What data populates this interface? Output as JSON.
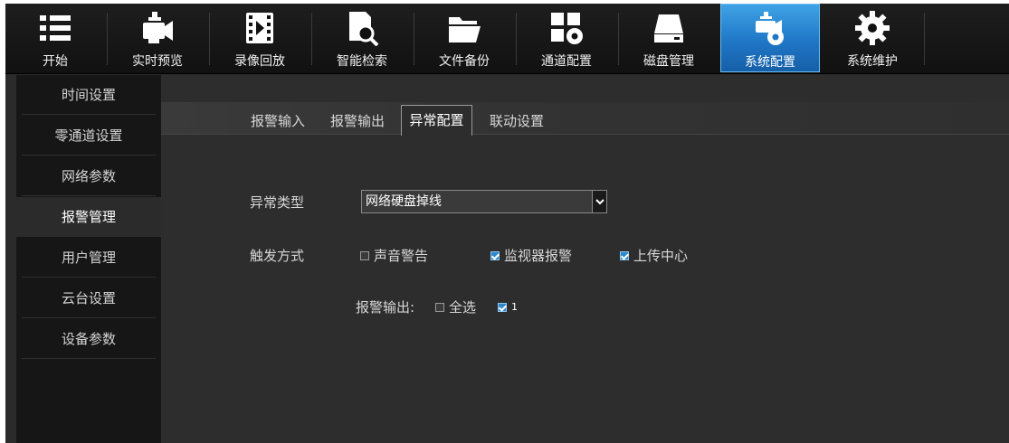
{
  "toolbar": {
    "items": [
      {
        "label": "开始",
        "icon": "list-icon"
      },
      {
        "label": "实时预览",
        "icon": "camera-icon"
      },
      {
        "label": "录像回放",
        "icon": "film-icon"
      },
      {
        "label": "智能检索",
        "icon": "search-document-icon"
      },
      {
        "label": "文件备份",
        "icon": "folder-icon"
      },
      {
        "label": "通道配置",
        "icon": "channel-config-icon"
      },
      {
        "label": "磁盘管理",
        "icon": "disk-icon"
      },
      {
        "label": "系统配置",
        "icon": "camera-gear-icon"
      },
      {
        "label": "系统维护",
        "icon": "gear-icon"
      }
    ],
    "active_index": 7,
    "active_color": "#1f77c6"
  },
  "sidebar": {
    "items": [
      {
        "label": "时间设置"
      },
      {
        "label": "零通道设置"
      },
      {
        "label": "网络参数"
      },
      {
        "label": "报警管理"
      },
      {
        "label": "用户管理"
      },
      {
        "label": "云台设置"
      },
      {
        "label": "设备参数"
      }
    ],
    "active_index": 3
  },
  "tabs": {
    "items": [
      {
        "label": "报警输入"
      },
      {
        "label": "报警输出"
      },
      {
        "label": "异常配置"
      },
      {
        "label": "联动设置"
      }
    ],
    "active_index": 2
  },
  "form": {
    "type_label": "异常类型",
    "type_value": "网络硬盘掉线",
    "trigger_label": "触发方式",
    "triggers": [
      {
        "label": "声音警告",
        "checked": false
      },
      {
        "label": "监视器报警",
        "checked": true
      },
      {
        "label": "上传中心",
        "checked": true
      }
    ],
    "alarm_output_label": "报警输出:",
    "select_all": {
      "label": "全选",
      "checked": false
    },
    "outputs": [
      {
        "label": "1",
        "checked": true
      }
    ]
  }
}
